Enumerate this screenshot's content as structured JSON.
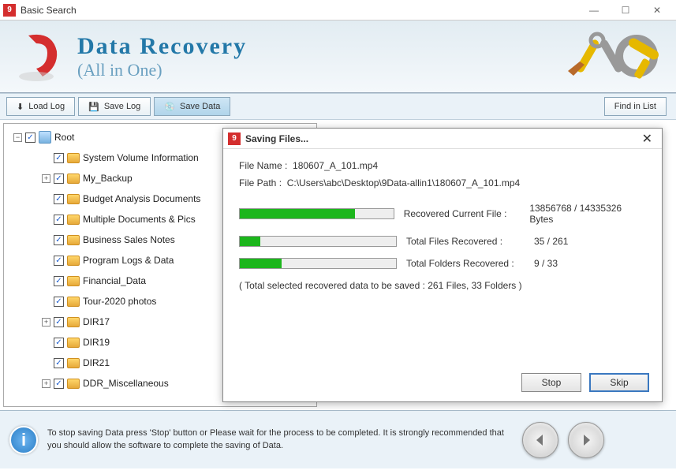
{
  "window": {
    "title": "Basic Search"
  },
  "banner": {
    "title": "Data Recovery",
    "subtitle": "(All in One)"
  },
  "toolbar": {
    "load_log": "Load Log",
    "save_log": "Save Log",
    "save_data": "Save Data",
    "find_in_list": "Find in List"
  },
  "tree": {
    "root": "Root",
    "items": [
      "System Volume Information",
      "My_Backup",
      "Budget Analysis Documents",
      "Multiple Documents & Pics",
      "Business Sales Notes",
      "Program Logs & Data",
      "Financial_Data",
      "Tour-2020 photos",
      "DIR17",
      "DIR19",
      "DIR21",
      "DDR_Miscellaneous"
    ]
  },
  "dialog": {
    "title": "Saving Files...",
    "filename_label": "File Name :",
    "filename": "180607_A_101.mp4",
    "filepath_label": "File Path :",
    "filepath": "C:\\Users\\abc\\Desktop\\9Data-allin1\\180607_A_101.mp4",
    "p1_label": "Recovered Current File :",
    "p1_value": "13856768 / 14335326 Bytes",
    "p1_pct": 75,
    "p2_label": "Total Files Recovered :",
    "p2_value": "35 / 261",
    "p2_pct": 13,
    "p3_label": "Total Folders Recovered :",
    "p3_value": "9 / 33",
    "p3_pct": 27,
    "summary": "( Total selected recovered data to be saved : 261 Files, 33 Folders )",
    "stop": "Stop",
    "skip": "Skip"
  },
  "footer": {
    "text": "To stop saving Data press 'Stop' button or Please wait for the process to be completed. It is strongly recommended that you should allow the software to complete the saving of Data."
  }
}
